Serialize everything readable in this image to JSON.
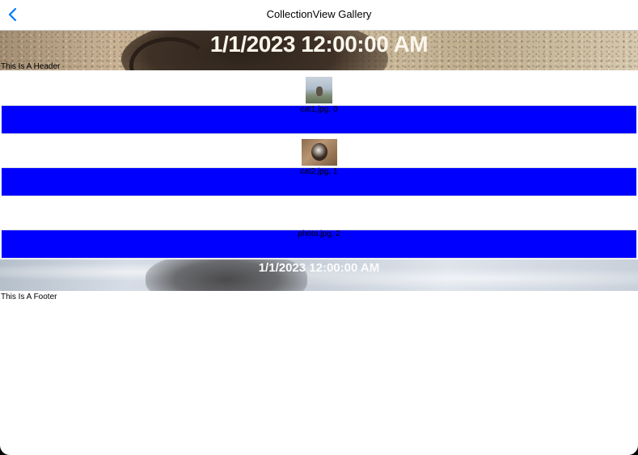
{
  "navbar": {
    "title": "CollectionView Gallery",
    "back_icon": "chevron-left-icon",
    "accent_color": "#007aff"
  },
  "header": {
    "date_text": "1/1/2023 12:00:00 AM",
    "label": "This Is A Header"
  },
  "items": [
    {
      "caption": "cat1.jpg, 0"
    },
    {
      "caption": "cat2.jpg, 1"
    },
    {
      "caption": "photo.jpg, 2"
    }
  ],
  "footer": {
    "date_text": "1/1/2023 12:00:00 AM",
    "label": "This Is A Footer"
  },
  "colors": {
    "item_bar": "#0000ff"
  }
}
